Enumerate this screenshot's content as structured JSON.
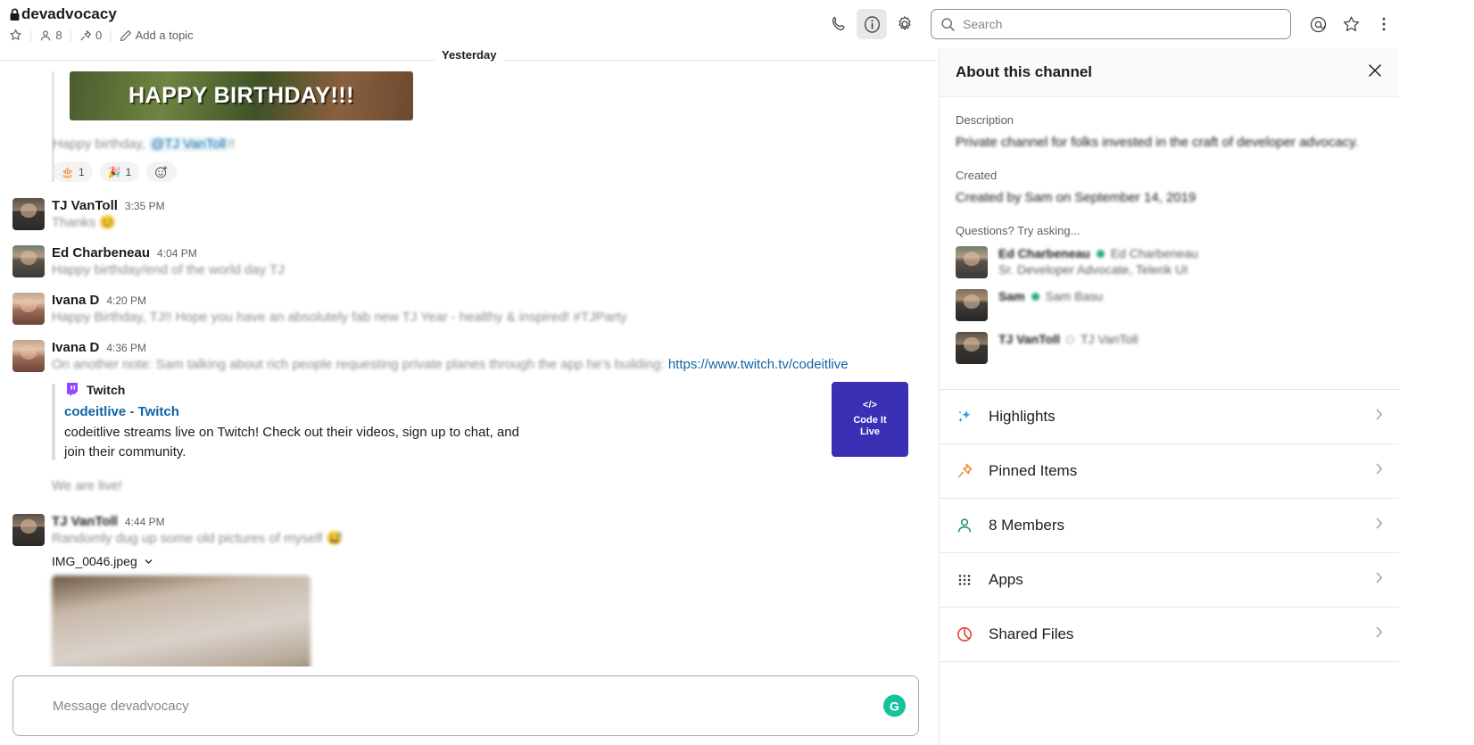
{
  "header": {
    "channel_name": "devadvocacy",
    "lock_icon": "lock-icon",
    "star_icon": "star-outline-icon",
    "members_icon": "person-icon",
    "member_count": "8",
    "pin_icon": "pin-icon",
    "pin_count": "0",
    "pencil_icon": "pencil-icon",
    "add_topic": "Add a topic",
    "separator": "|"
  },
  "toolbar": {
    "call_icon": "phone-icon",
    "info_icon": "info-circle-icon",
    "settings_icon": "gear-icon",
    "mention_icon": "at-mention-icon",
    "starred_icon": "star-outline-icon",
    "more_icon": "kebab-menu-icon"
  },
  "search": {
    "placeholder": "Search",
    "value": "",
    "icon": "search-icon"
  },
  "messages": {
    "day_divider": "Yesterday",
    "birthday_image_text": "HAPPY BIRTHDAY!!!",
    "birthday_msg_prefix": "Happy birthday, ",
    "birthday_msg_mention": "@TJ VanToll",
    "birthday_msg_suffix": "!!",
    "reactions": [
      {
        "emoji": "🎂",
        "name": "birthday-cake-emoji",
        "count": "1"
      },
      {
        "emoji": "🎉",
        "name": "party-popper-emoji",
        "count": "1"
      }
    ],
    "add_reaction_icon": "add-reaction-icon",
    "items": [
      {
        "author": "TJ VanToll",
        "time": "3:35 PM",
        "text": "Thanks 😊",
        "avatar": "f-tj"
      },
      {
        "author": "Ed Charbeneau",
        "time": "4:04 PM",
        "text": "Happy birthday/end of the world day TJ",
        "avatar": "f-ed"
      },
      {
        "author": "Ivana D",
        "time": "4:20 PM",
        "text": "Happy Birthday, TJ!! Hope you have an absolutely fab new TJ Year - healthy & inspired! #TJParty",
        "avatar": "f-ivana"
      },
      {
        "author": "Ivana D",
        "time": "4:36 PM",
        "text": "On another note: Sam talking about rich people requesting private planes through the app he's building: ",
        "link": "https://www.twitch.tv/codeitlive",
        "avatar": "f-ivana"
      }
    ],
    "unfurl": {
      "source": "Twitch",
      "source_icon": "twitch-icon",
      "title": "codeitlive - Twitch",
      "description": "codeitlive streams live on Twitch! Check out their videos, sign up to chat, and join their community.",
      "thumb_glyph": "</>",
      "thumb_line1": "Code It",
      "thumb_line2": "Live"
    },
    "we_are_live": "We are live!",
    "last_message": {
      "author": "TJ VanToll",
      "time": "4:44 PM",
      "text": "Randomly dug up some old pictures of myself 😅",
      "avatar": "f-tj",
      "filename": "IMG_0046.jpeg",
      "file_menu_icon": "chevron-down-icon"
    }
  },
  "composer": {
    "placeholder": "Message devadvocacy",
    "value": "",
    "grammarly_icon": "grammarly-icon",
    "grammarly_glyph": "G"
  },
  "panel": {
    "title": "About this channel",
    "close_icon": "close-icon",
    "description_label": "Description",
    "description_value": "Private channel for folks invested in the craft of developer advocacy.",
    "created_label": "Created",
    "created_value": "Created by Sam on September 14, 2019",
    "questions_label": "Questions? Try asking...",
    "people": [
      {
        "name": "Ed Charbeneau",
        "handle": "Ed Charbeneau",
        "status": "online",
        "role": "Sr. Developer Advocate, Telerik UI",
        "avatar": "f-ed"
      },
      {
        "name": "Sam",
        "handle": "Sam Basu",
        "status": "online",
        "role": "",
        "avatar": "f-sam"
      },
      {
        "name": "TJ VanToll",
        "handle": "TJ VanToll",
        "status": "away",
        "role": "",
        "avatar": "f-tj"
      }
    ],
    "rows": [
      {
        "label": "Highlights",
        "icon": "sparkle-icon",
        "color": "#2a9fd6"
      },
      {
        "label": "Pinned Items",
        "icon": "pin-icon",
        "color": "#e8912d"
      },
      {
        "label": "8 Members",
        "icon": "person-icon",
        "color": "#1a8f73"
      },
      {
        "label": "Apps",
        "icon": "apps-grid-icon",
        "color": "#2c2c2c"
      },
      {
        "label": "Shared Files",
        "icon": "shared-files-icon",
        "color": "#e0453a"
      }
    ],
    "chevron_icon": "chevron-right-icon"
  },
  "colors": {
    "link": "#1264a3",
    "accent_green": "#15c39a",
    "online": "#2bac76",
    "twitch_purple": "#9146ff"
  }
}
